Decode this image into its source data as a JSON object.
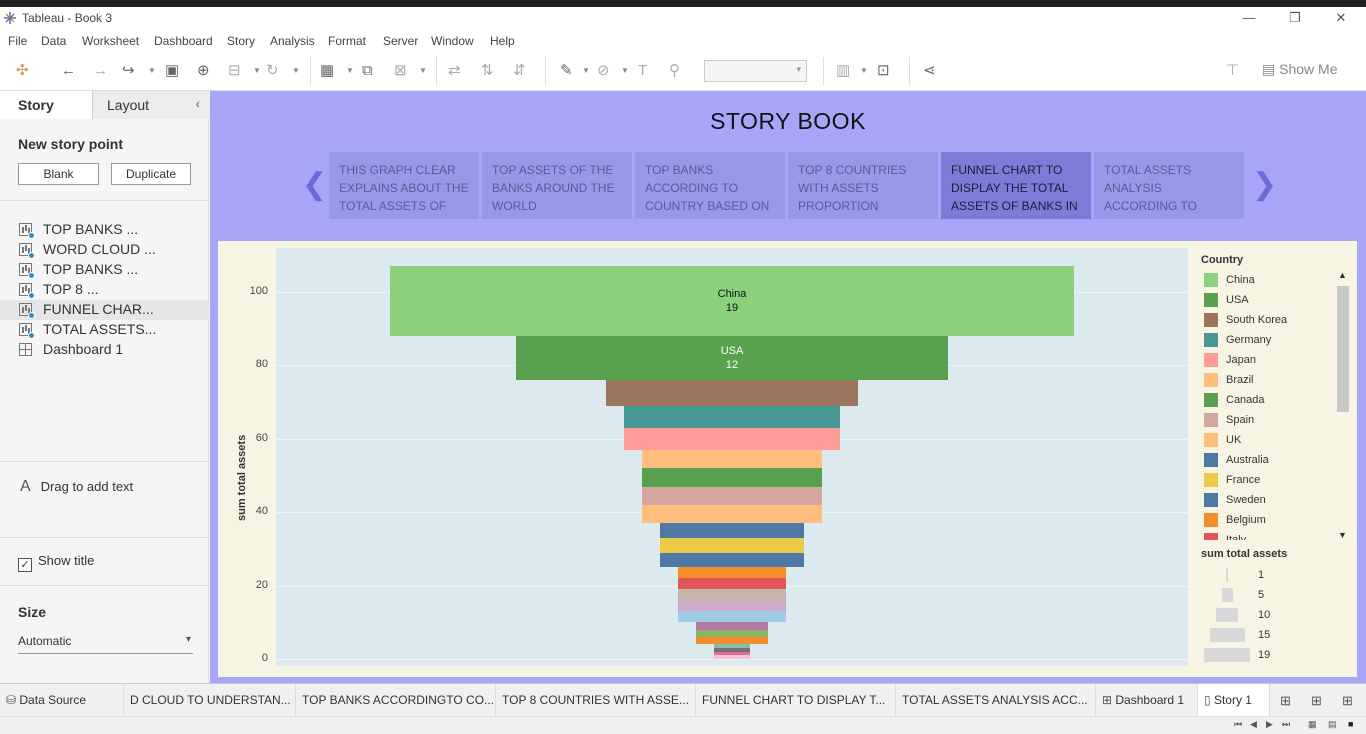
{
  "window": {
    "title": "Tableau - Book 3",
    "minimize": "—",
    "restore": "❐",
    "close": "✕"
  },
  "menu": [
    "File",
    "Data",
    "Worksheet",
    "Dashboard",
    "Story",
    "Analysis",
    "Format",
    "Server",
    "Window",
    "Help"
  ],
  "toolbar": {
    "show_me": "Show Me"
  },
  "left_pane": {
    "tab_story": "Story",
    "tab_layout": "Layout",
    "collapse": "‹",
    "new_story_point": "New story point",
    "blank_button": "Blank",
    "duplicate_button": "Duplicate",
    "sheets": [
      {
        "label": "TOP BANKS ...",
        "kind": "sheet"
      },
      {
        "label": "WORD CLOUD ...",
        "kind": "sheet"
      },
      {
        "label": "TOP BANKS ...",
        "kind": "sheet"
      },
      {
        "label": "TOP 8 ...",
        "kind": "sheet"
      },
      {
        "label": "FUNNEL CHAR...",
        "kind": "sheet",
        "active": true
      },
      {
        "label": "TOTAL ASSETS...",
        "kind": "sheet"
      },
      {
        "label": "Dashboard 1",
        "kind": "dashboard"
      }
    ],
    "drag_text_icon": "A",
    "drag_text": "Drag to add text",
    "show_title": "Show title",
    "size_heading": "Size",
    "size_value": "Automatic"
  },
  "story": {
    "title": "STORY BOOK",
    "prev_arrow": "❮",
    "next_arrow": "❯",
    "points": [
      {
        "text": "THIS GRAPH CLEAR EXPLAINS ABOUT THE TOTAL ASSETS OF THE"
      },
      {
        "text": "TOP ASSETS OF THE BANKS AROUND THE WORLD"
      },
      {
        "text": "TOP BANKS ACCORDING TO COUNTRY BASED ON"
      },
      {
        "text": "TOP 8 COUNTRIES WITH ASSETS PROPORTION"
      },
      {
        "text": "FUNNEL CHART TO DISPLAY THE TOTAL ASSETS OF BANKS IN A",
        "active": true
      },
      {
        "text": "TOTAL ASSETS ANALYSIS ACCORDING TO QUARTER AND"
      }
    ]
  },
  "chart_data": {
    "type": "bar",
    "orientation": "funnel",
    "ylabel": "sum total assets",
    "ylim": [
      0,
      110
    ],
    "yticks": [
      0,
      20,
      40,
      60,
      80,
      100
    ],
    "grid": true,
    "series": [
      {
        "name": "China",
        "value": 19,
        "color": "#8bd17c",
        "labeled": true
      },
      {
        "name": "USA",
        "value": 12,
        "color": "#59a14f",
        "labeled": true
      },
      {
        "name": "South Korea",
        "value": 7,
        "color": "#9c755f"
      },
      {
        "name": "Germany",
        "value": 6,
        "color": "#499894"
      },
      {
        "name": "Japan",
        "value": 6,
        "color": "#ff9d9a"
      },
      {
        "name": "Brazil",
        "value": 5,
        "color": "#ffbe7d"
      },
      {
        "name": "Canada",
        "value": 5,
        "color": "#59a14f"
      },
      {
        "name": "Spain",
        "value": 5,
        "color": "#d4a6a0"
      },
      {
        "name": "UK",
        "value": 5,
        "color": "#ffbe7d"
      },
      {
        "name": "Australia",
        "value": 4,
        "color": "#4e79a7"
      },
      {
        "name": "France",
        "value": 4,
        "color": "#edc948"
      },
      {
        "name": "Sweden",
        "value": 4,
        "color": "#4e79a7"
      },
      {
        "name": "Belgium",
        "value": 3,
        "color": "#f28e2b"
      },
      {
        "name": "Italy",
        "value": 3,
        "color": "#e15759"
      },
      {
        "name": "",
        "value": 3,
        "color": "#c4b5a8"
      },
      {
        "name": "",
        "value": 3,
        "color": "#d0a8c8"
      },
      {
        "name": "",
        "value": 3,
        "color": "#a0cbe8"
      },
      {
        "name": "",
        "value": 2,
        "color": "#b07aa1"
      },
      {
        "name": "",
        "value": 2,
        "color": "#8cb369"
      },
      {
        "name": "",
        "value": 2,
        "color": "#f28e2b"
      },
      {
        "name": "",
        "value": 1,
        "color": "#86bcb6"
      },
      {
        "name": "",
        "value": 1,
        "color": "#79706e"
      },
      {
        "name": "",
        "value": 1,
        "color": "#d37295"
      },
      {
        "name": "",
        "value": 1,
        "color": "#fabfd2"
      }
    ]
  },
  "legend": {
    "title": "Country",
    "items": [
      {
        "name": "China",
        "color": "#8bd17c"
      },
      {
        "name": "USA",
        "color": "#59a14f"
      },
      {
        "name": "South Korea",
        "color": "#9c755f"
      },
      {
        "name": "Germany",
        "color": "#499894"
      },
      {
        "name": "Japan",
        "color": "#ff9d9a"
      },
      {
        "name": "Brazil",
        "color": "#ffbe7d"
      },
      {
        "name": "Canada",
        "color": "#59a14f"
      },
      {
        "name": "Spain",
        "color": "#d4a6a0"
      },
      {
        "name": "UK",
        "color": "#ffbe7d"
      },
      {
        "name": "Australia",
        "color": "#4e79a7"
      },
      {
        "name": "France",
        "color": "#edc948"
      },
      {
        "name": "Sweden",
        "color": "#4e79a7"
      },
      {
        "name": "Belgium",
        "color": "#f28e2b"
      },
      {
        "name": "Italy",
        "color": "#e15759"
      }
    ],
    "size_title": "sum total assets",
    "size_items": [
      "1",
      "5",
      "10",
      "15",
      "19"
    ]
  },
  "tabs": [
    {
      "label": "Data Source",
      "icon": "database-icon"
    },
    {
      "label": "D CLOUD TO UNDERSTAN..."
    },
    {
      "label": "TOP BANKS ACCORDINGTO CO..."
    },
    {
      "label": "TOP 8 COUNTRIES WITH ASSE..."
    },
    {
      "label": "FUNNEL CHART TO DISPLAY T..."
    },
    {
      "label": "TOTAL ASSETS ANALYSIS ACC..."
    },
    {
      "label": "Dashboard 1",
      "icon": "dashboard-icon"
    },
    {
      "label": "Story 1",
      "icon": "story-icon",
      "active": true
    }
  ]
}
